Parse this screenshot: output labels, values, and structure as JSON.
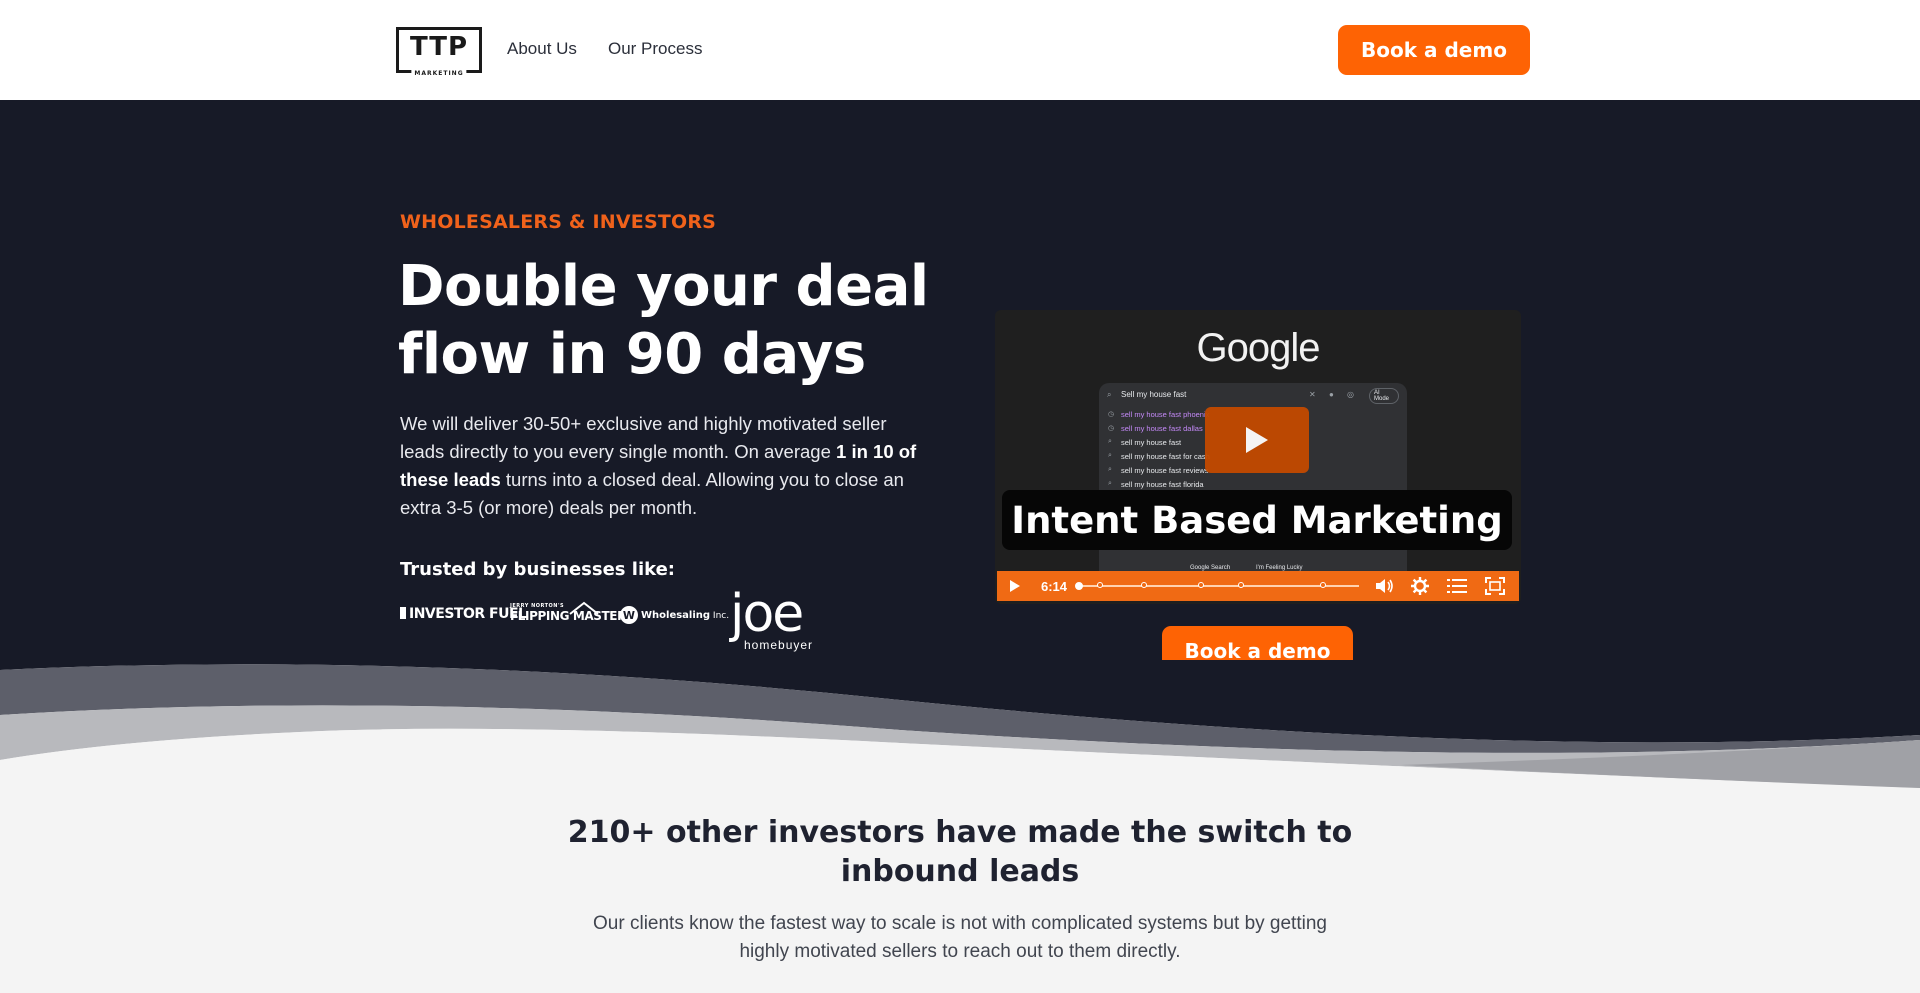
{
  "nav": {
    "logo_text": "TTP",
    "logo_subtext": "MARKETING",
    "links": [
      "About Us",
      "Our Process"
    ],
    "cta_label": "Book a demo"
  },
  "hero": {
    "eyebrow": "WHOLESALERS & INVESTORS",
    "headline": "Double your deal flow in 90 days",
    "body_part1": "We will deliver 30-50+ exclusive and highly motivated seller leads directly to you every single month. On average ",
    "body_bold": "1 in 10 of these leads",
    "body_part2": " turns into a closed deal. Allowing you to close an extra 3-5 (or more) deals per month.",
    "trusted_label": "Trusted by businesses like:",
    "brands": {
      "investor_fuel": "INVESTOR FUEL",
      "flipping_small": "JERRY NORTON'S",
      "flipping_big": "FLIPPING MASTERY",
      "wholesaling_mark": "W",
      "wholesaling_name": "Wholesaling",
      "wholesaling_suffix": " Inc.",
      "joe_big": "joe",
      "joe_small": "homebuyer"
    },
    "cta_label": "Book a demo"
  },
  "video": {
    "google_logo": "Google",
    "search_query": "Sell my house fast",
    "ai_mode": "AI Mode",
    "suggestions": [
      "sell my house fast phoenix",
      "sell my house fast dallas",
      "sell my house fast",
      "sell my house fast for cash",
      "sell my house fast reviews",
      "sell my house fast florida"
    ],
    "google_search_btn": "Google Search",
    "lucky_btn": "I'm Feeling Lucky",
    "overlay_title": "Intent Based Marketing",
    "duration": "6:14",
    "accent_color": "#f06a14"
  },
  "section2": {
    "title": "210+ other investors have made the switch to inbound leads",
    "subtitle": "Our clients know the fastest way to scale is not with complicated systems but by getting highly motivated sellers to reach out to them directly."
  },
  "colors": {
    "brand_orange": "#fe6304",
    "hero_bg": "#171a27",
    "page_bg": "#f4f4f4"
  }
}
